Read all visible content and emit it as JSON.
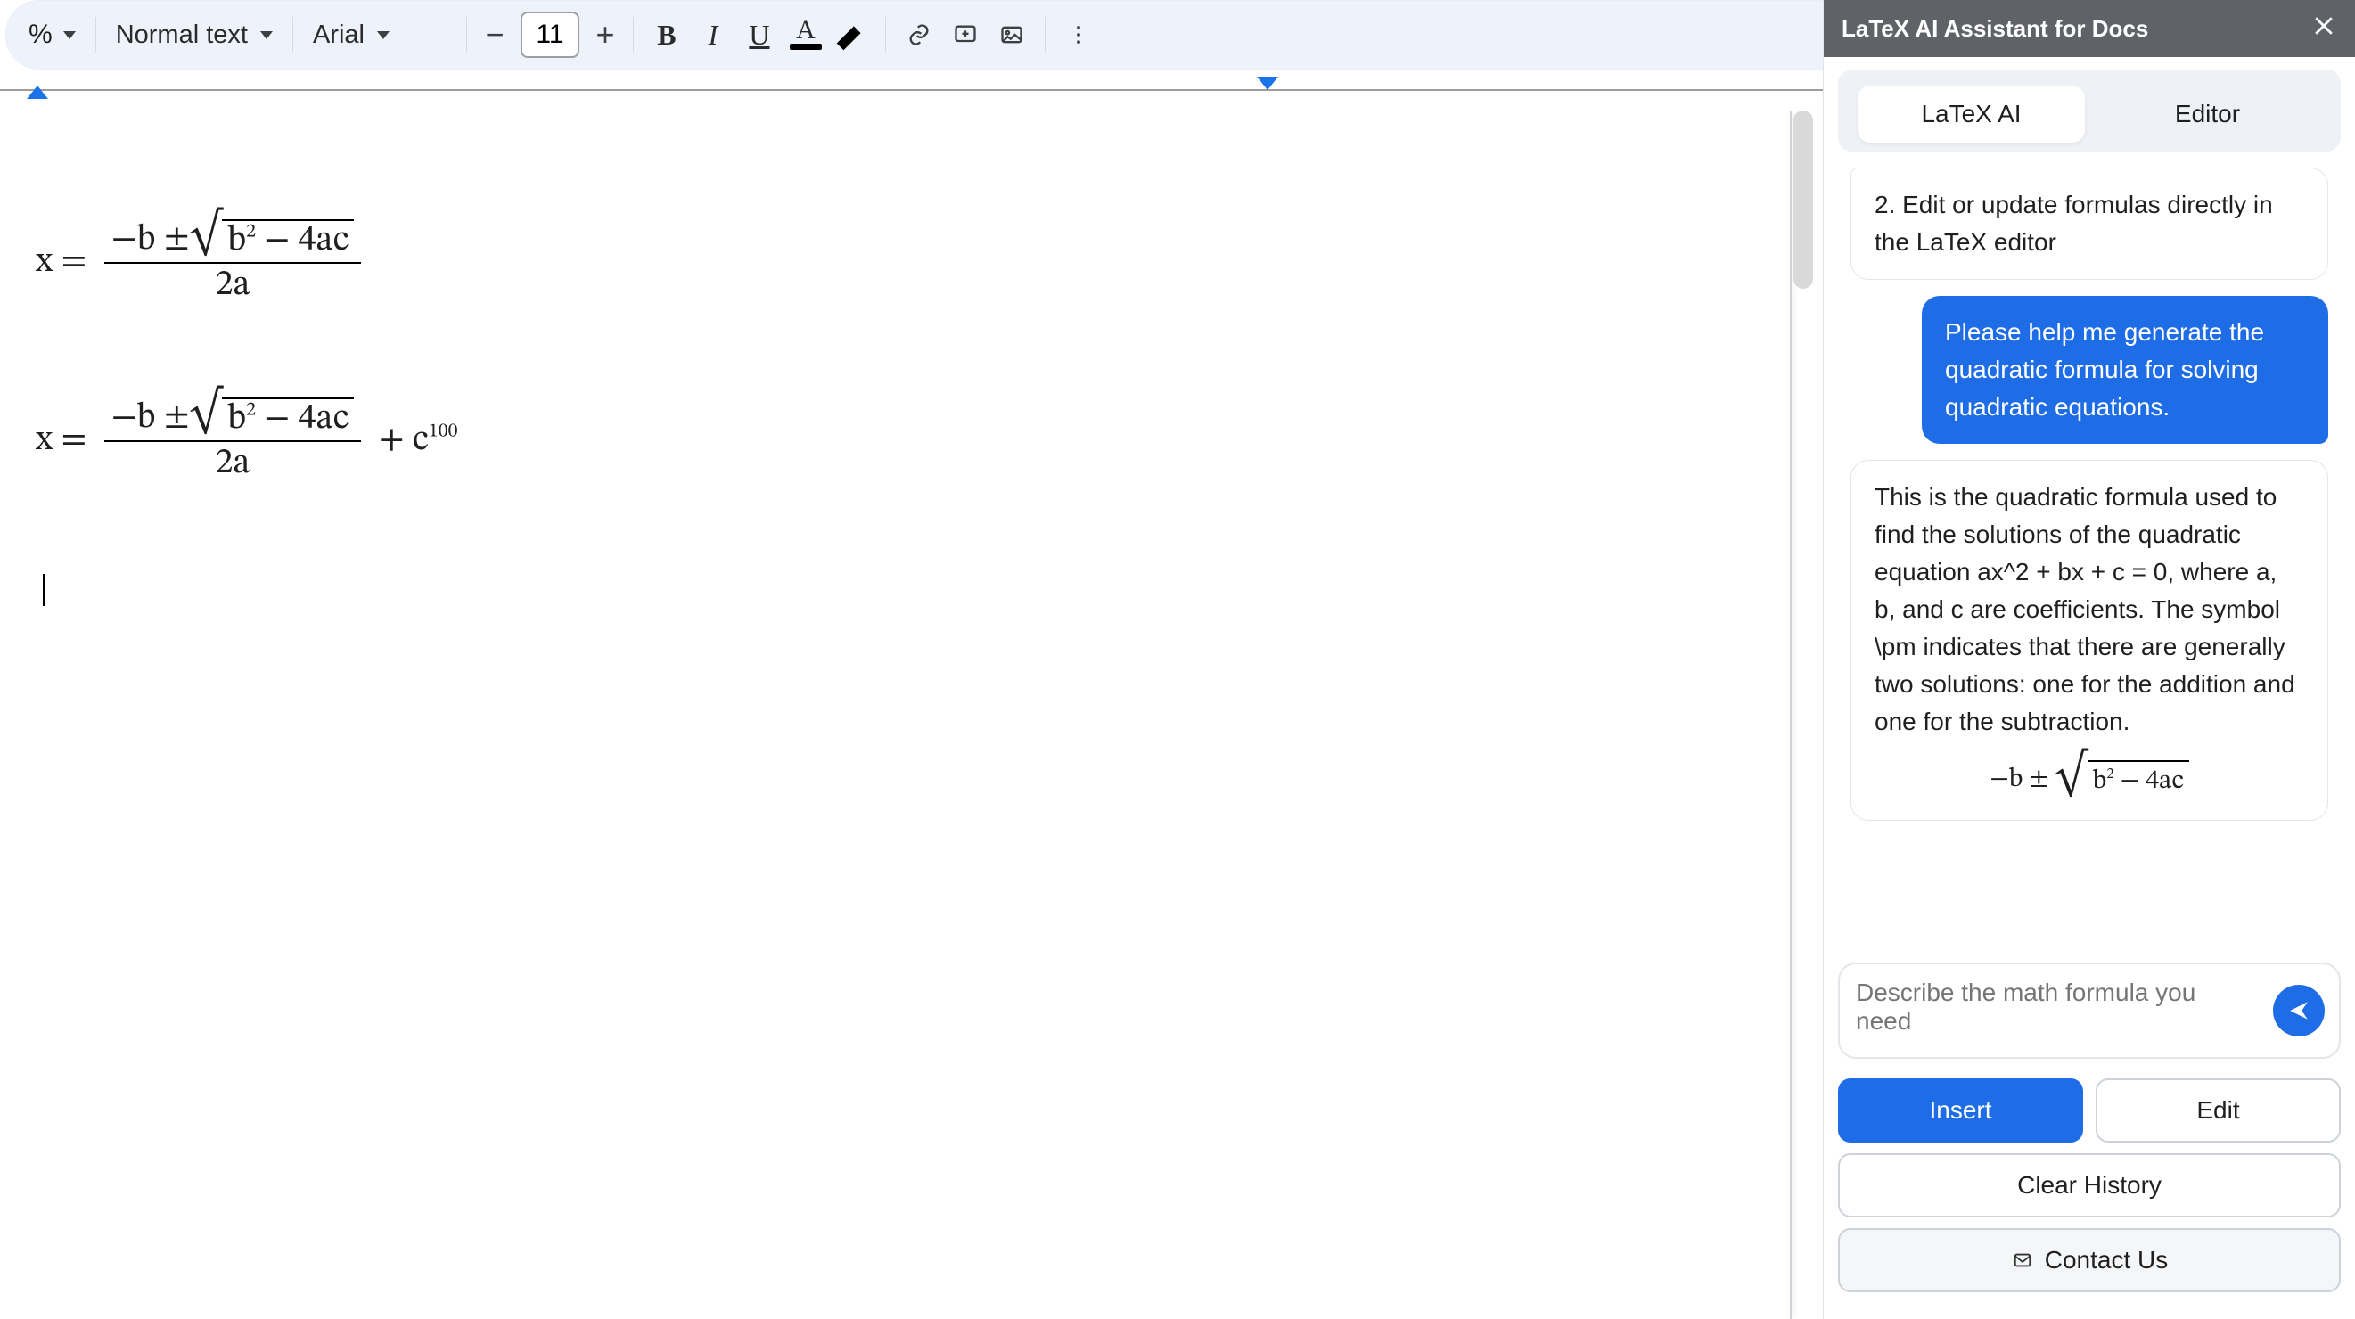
{
  "toolbar": {
    "zoom_dropdown_symbol": "%",
    "style_name": "Normal text",
    "font_name": "Arial",
    "font_size": "11",
    "bold": "B",
    "italic": "I",
    "underline": "U",
    "text_color_letter": "A"
  },
  "document": {
    "formula1_prefix": "x =",
    "formula1_num_a": "−b ± ",
    "formula1_sqrt": "b",
    "formula1_sqrt_exp": "2",
    "formula1_sqrt_tail": " − 4ac",
    "formula1_den": "2a",
    "formula2_prefix": "x =",
    "formula2_num_a": "−b ± ",
    "formula2_sqrt": "b",
    "formula2_sqrt_exp": "2",
    "formula2_sqrt_tail": " − 4ac",
    "formula2_den": "2a",
    "formula2_tail_plus": " + c",
    "formula2_tail_exp": "100"
  },
  "panel": {
    "title": "LaTeX AI Assistant for Docs",
    "tabs": {
      "latex": "LaTeX AI",
      "editor": "Editor"
    },
    "messages": {
      "tip_line": "2. Edit or update formulas directly in the LaTeX editor",
      "user_prompt": "Please help me generate the quadratic formula for solving quadratic equations.",
      "ai_text": "This is the quadratic formula used to find the solutions of the quadratic equation ax^2 + bx + c = 0, where a, b, and c are coefficients. The symbol \\pm indicates that there are generally two solutions: one for the addition and one for the subtraction.",
      "ai_formula_num": "−b ± ",
      "ai_formula_sqrt_b": "b",
      "ai_formula_sqrt_exp": "2",
      "ai_formula_sqrt_tail": " − 4ac"
    },
    "input_placeholder": "Describe the math formula you need",
    "buttons": {
      "insert": "Insert",
      "edit": "Edit",
      "clear": "Clear History",
      "contact": "Contact Us"
    }
  }
}
